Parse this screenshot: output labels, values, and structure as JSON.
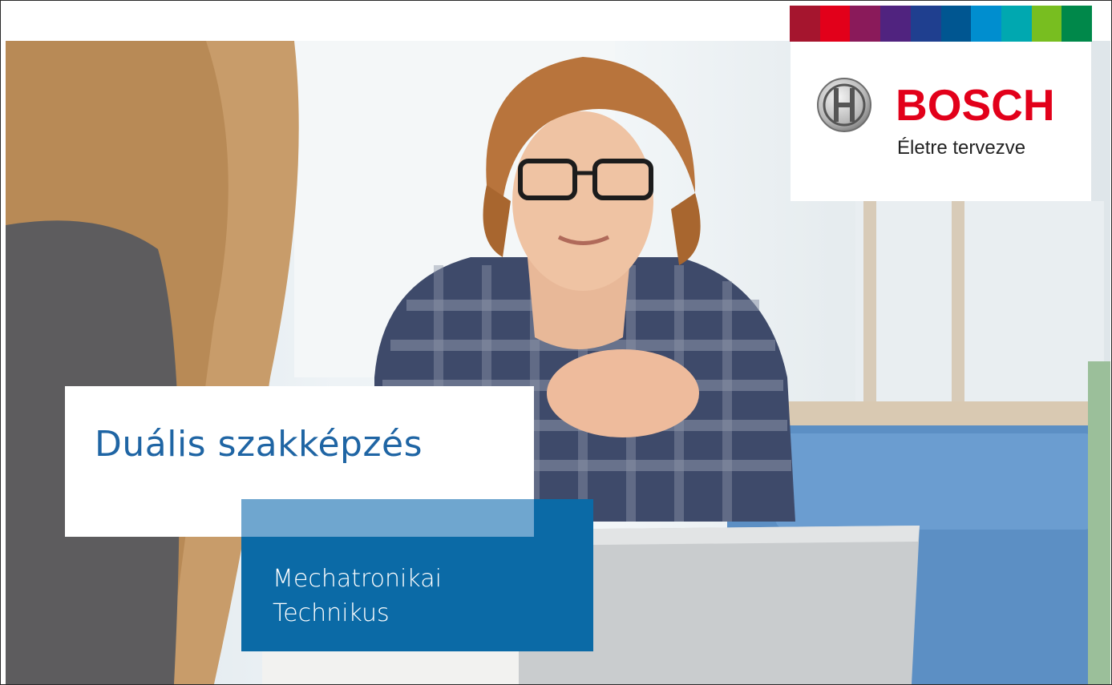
{
  "brand": {
    "name": "BOSCH",
    "tagline": "Életre tervezve",
    "color": "#e2001a",
    "emblem_icon": "bosch-armature-icon"
  },
  "stripe_colors": [
    "#a5152e",
    "#e2001a",
    "#8a1a5a",
    "#50237f",
    "#1f3f8f",
    "#005691",
    "#008ecf",
    "#00a8b0",
    "#78be20",
    "#00884a"
  ],
  "headline": {
    "title": "Duális szakképzés",
    "subtitle_line1": "Mechatronikai",
    "subtitle_line2": "Technikus",
    "title_color": "#1f65a4",
    "box_color": "#0b6aa6"
  }
}
